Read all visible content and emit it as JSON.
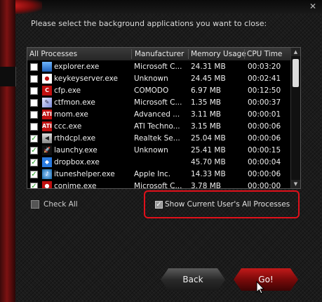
{
  "instruction": "Please select the background applications you want to close:",
  "table": {
    "headers": [
      "All Processes",
      "Manufacturer",
      "Memory Usage",
      "CPU Time"
    ],
    "rows": [
      {
        "name": "explorer.exe",
        "manufacturer": "Microsoft C...",
        "memory": "24.31 MB",
        "cpu": "00:03:20",
        "checked": false,
        "icon": "explorer-icon"
      },
      {
        "name": "keykeyserver.exe",
        "manufacturer": "Unknown",
        "memory": "24.45 MB",
        "cpu": "00:02:41",
        "checked": false,
        "icon": "keykey-icon"
      },
      {
        "name": "cfp.exe",
        "manufacturer": "COMODO",
        "memory": "6.97 MB",
        "cpu": "00:12:50",
        "checked": false,
        "icon": "comodo-icon"
      },
      {
        "name": "ctfmon.exe",
        "manufacturer": "Microsoft C...",
        "memory": "1.35 MB",
        "cpu": "00:00:37",
        "checked": false,
        "icon": "ctfmon-icon"
      },
      {
        "name": "mom.exe",
        "manufacturer": "Advanced ...",
        "memory": "3.11 MB",
        "cpu": "00:00:01",
        "checked": false,
        "icon": "ati-icon"
      },
      {
        "name": "ccc.exe",
        "manufacturer": "ATI Techno...",
        "memory": "3.15 MB",
        "cpu": "00:00:06",
        "checked": false,
        "icon": "ati-icon"
      },
      {
        "name": "rthdcpl.exe",
        "manufacturer": "Realtek Se...",
        "memory": "25.04 MB",
        "cpu": "00:00:06",
        "checked": true,
        "icon": "speaker-icon"
      },
      {
        "name": "launchy.exe",
        "manufacturer": "Unknown",
        "memory": "25.41 MB",
        "cpu": "00:00:15",
        "checked": true,
        "icon": "launchy-icon"
      },
      {
        "name": "dropbox.exe",
        "manufacturer": "",
        "memory": "45.70 MB",
        "cpu": "00:00:04",
        "checked": true,
        "icon": "dropbox-icon"
      },
      {
        "name": "ituneshelper.exe",
        "manufacturer": "Apple Inc.",
        "memory": "14.33 MB",
        "cpu": "00:00:06",
        "checked": true,
        "icon": "itunes-icon"
      },
      {
        "name": "conime.exe",
        "manufacturer": "Microsoft C...",
        "memory": "3.78 MB",
        "cpu": "00:00:00",
        "checked": true,
        "icon": "conime-icon"
      }
    ]
  },
  "check_all_label": "Check All",
  "show_all_label": "Show Current User's All Processes",
  "buttons": {
    "back": "Back",
    "go": "Go!"
  },
  "colors": {
    "accent": "#e0101a",
    "check": "#1a9a1a",
    "background": "#1b1b1b"
  }
}
